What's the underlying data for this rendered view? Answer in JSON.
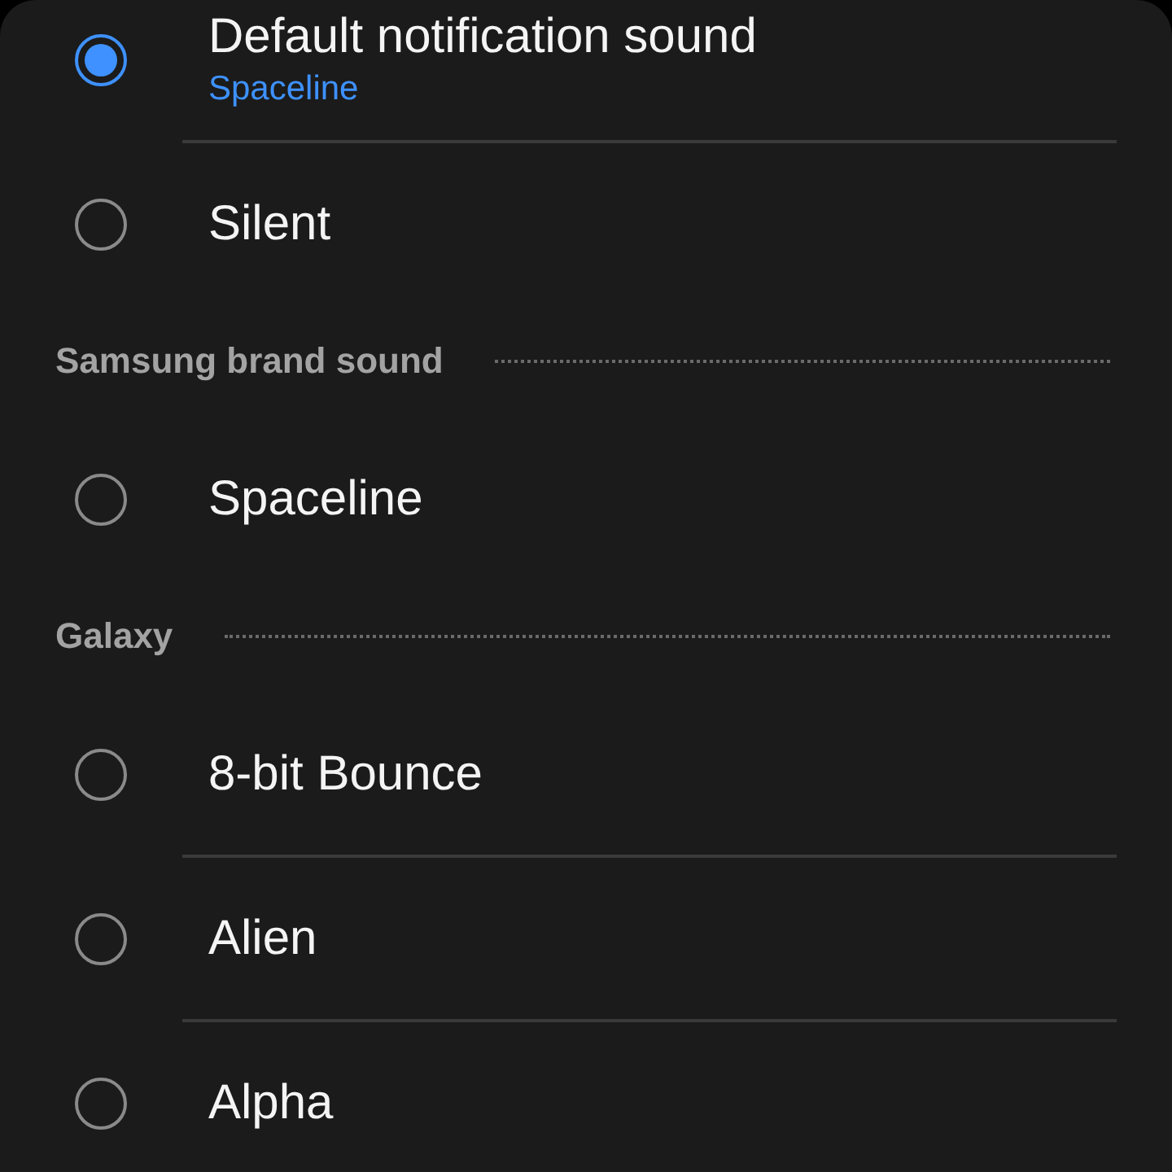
{
  "items": [
    {
      "kind": "option",
      "label": "Default notification sound",
      "subtitle": "Spaceline",
      "selected": true
    },
    {
      "kind": "option",
      "label": "Silent",
      "selected": false
    },
    {
      "kind": "header",
      "label": "Samsung brand sound"
    },
    {
      "kind": "option",
      "label": "Spaceline",
      "selected": false
    },
    {
      "kind": "header",
      "label": "Galaxy"
    },
    {
      "kind": "option",
      "label": "8-bit Bounce",
      "selected": false
    },
    {
      "kind": "option",
      "label": "Alien",
      "selected": false
    },
    {
      "kind": "option",
      "label": "Alpha",
      "selected": false
    }
  ]
}
